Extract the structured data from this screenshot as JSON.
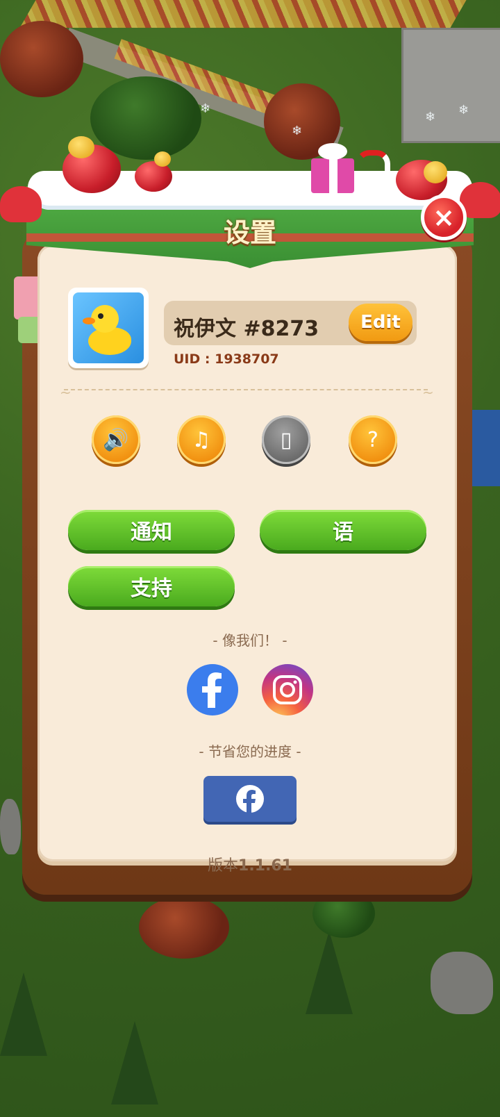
{
  "dialog": {
    "title": "设置",
    "close_label": "×"
  },
  "profile": {
    "name": "祝伊文 #8273",
    "edit_label": "Edit",
    "uid_label": "UID : 1938707",
    "avatar_icon": "yellow-duck-icon"
  },
  "toggles": [
    {
      "icon": "speaker-icon",
      "glyph": "🔊",
      "state": "on"
    },
    {
      "icon": "music-note-icon",
      "glyph": "♫",
      "state": "on"
    },
    {
      "icon": "vibration-icon",
      "glyph": "▯",
      "state": "off"
    },
    {
      "icon": "hint-bulb-icon",
      "glyph": "?",
      "state": "on"
    }
  ],
  "buttons": {
    "notify": "通知",
    "language": "语",
    "support": "支持"
  },
  "social": {
    "like_label": "- 像我们！ -",
    "save_label": "- 节省您的进度 -"
  },
  "version": {
    "prefix": "版本",
    "number": "1.1.61"
  },
  "colors": {
    "accent_green": "#4aaa1e",
    "accent_orange": "#f19a12",
    "close_red": "#d8222a",
    "facebook_blue": "#3b7ded"
  }
}
